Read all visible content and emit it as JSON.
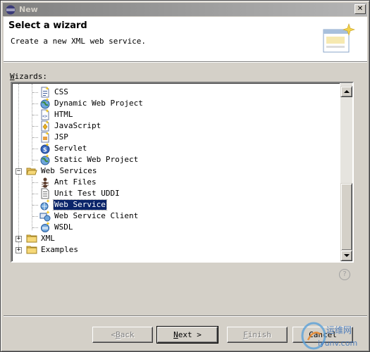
{
  "window": {
    "title": "New"
  },
  "header": {
    "heading": "Select a wizard",
    "description": "Create a new XML web service."
  },
  "wizards_label_prefix": "W",
  "wizards_label_rest": "izards:",
  "tree": {
    "items": [
      {
        "label": "CSS",
        "icon": "css-file-icon"
      },
      {
        "label": "Dynamic Web Project",
        "icon": "web-project-icon"
      },
      {
        "label": "HTML",
        "icon": "html-file-icon"
      },
      {
        "label": "JavaScript",
        "icon": "javascript-file-icon"
      },
      {
        "label": "JSP",
        "icon": "jsp-file-icon"
      },
      {
        "label": "Servlet",
        "icon": "servlet-icon"
      },
      {
        "label": "Static Web Project",
        "icon": "web-project-icon"
      },
      {
        "label": "Web Services",
        "icon": "folder-open-icon",
        "expanded": true
      },
      {
        "label": "Ant Files",
        "icon": "ant-icon"
      },
      {
        "label": "Unit Test UDDI",
        "icon": "document-icon"
      },
      {
        "label": "Web Service",
        "icon": "web-service-icon",
        "selected": true
      },
      {
        "label": "Web Service Client",
        "icon": "web-service-client-icon"
      },
      {
        "label": "WSDL",
        "icon": "wsdl-icon"
      },
      {
        "label": "XML",
        "icon": "folder-closed-icon",
        "expanded": false
      },
      {
        "label": "Examples",
        "icon": "folder-closed-icon",
        "expanded": false
      }
    ]
  },
  "buttons": {
    "back_u": "B",
    "back_prefix": "< ",
    "back_rest": "ack",
    "next_u": "N",
    "next_rest": "ext >",
    "finish_u": "F",
    "finish_rest": "inish",
    "cancel": "Cancel"
  },
  "watermark": {
    "text_cn": "运维网",
    "text_url": "iyunv.com"
  },
  "colors": {
    "selection": "#0a246a",
    "dialog_bg": "#d4d0c8",
    "folder": "#f0c040"
  }
}
